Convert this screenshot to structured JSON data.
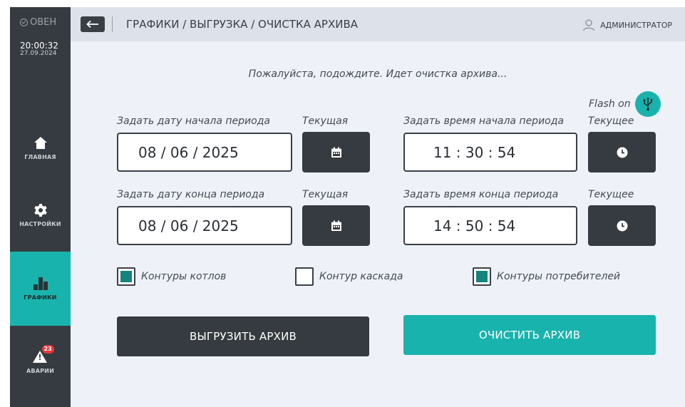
{
  "sidebar": {
    "brand": "ОВЕН",
    "time": "20:00:32",
    "date": "27.09.2024",
    "items": [
      {
        "label": "ГЛАВНАЯ",
        "icon": "home-icon"
      },
      {
        "label": "НАСТРОЙКИ",
        "icon": "gear-icon"
      },
      {
        "label": "ГРАФИКИ",
        "icon": "chart-icon",
        "active": true
      },
      {
        "label": "АВАРИИ",
        "icon": "alert-icon",
        "badge": "23"
      }
    ]
  },
  "header": {
    "breadcrumb": "ГРАФИКИ / ВЫГРУЗКА / ОЧИСТКА АРХИВА",
    "user": "АДМИНИСТРАТОР"
  },
  "main": {
    "status": "Пожалуйста, подождите. Идет очистка архива...",
    "flash_label": "Flash on",
    "start_date_label": "Задать дату начала периода",
    "start_date": "08 / 06 / 2025",
    "current_date_label": "Текущая",
    "start_time_label": "Задать время начала периода",
    "start_time": "11 : 30 : 54",
    "current_time_label": "Текущее",
    "end_date_label": "Задать дату конца периода",
    "end_date": "08 / 06 / 2025",
    "end_time_label": "Задать время конца периода",
    "end_time": "14 : 50 : 54",
    "checkboxes": [
      {
        "label": "Контуры котлов",
        "checked": true
      },
      {
        "label": "Контур каскада",
        "checked": false
      },
      {
        "label": "Контуры потребителей",
        "checked": true
      }
    ],
    "export_button": "ВЫГРУЗИТЬ АРХИВ",
    "clear_button": "ОЧИСТИТЬ АРХИВ"
  },
  "colors": {
    "accent": "#19b3ad",
    "sidebar": "#363b41",
    "background": "#eef2f8",
    "badge": "#e6393b"
  }
}
